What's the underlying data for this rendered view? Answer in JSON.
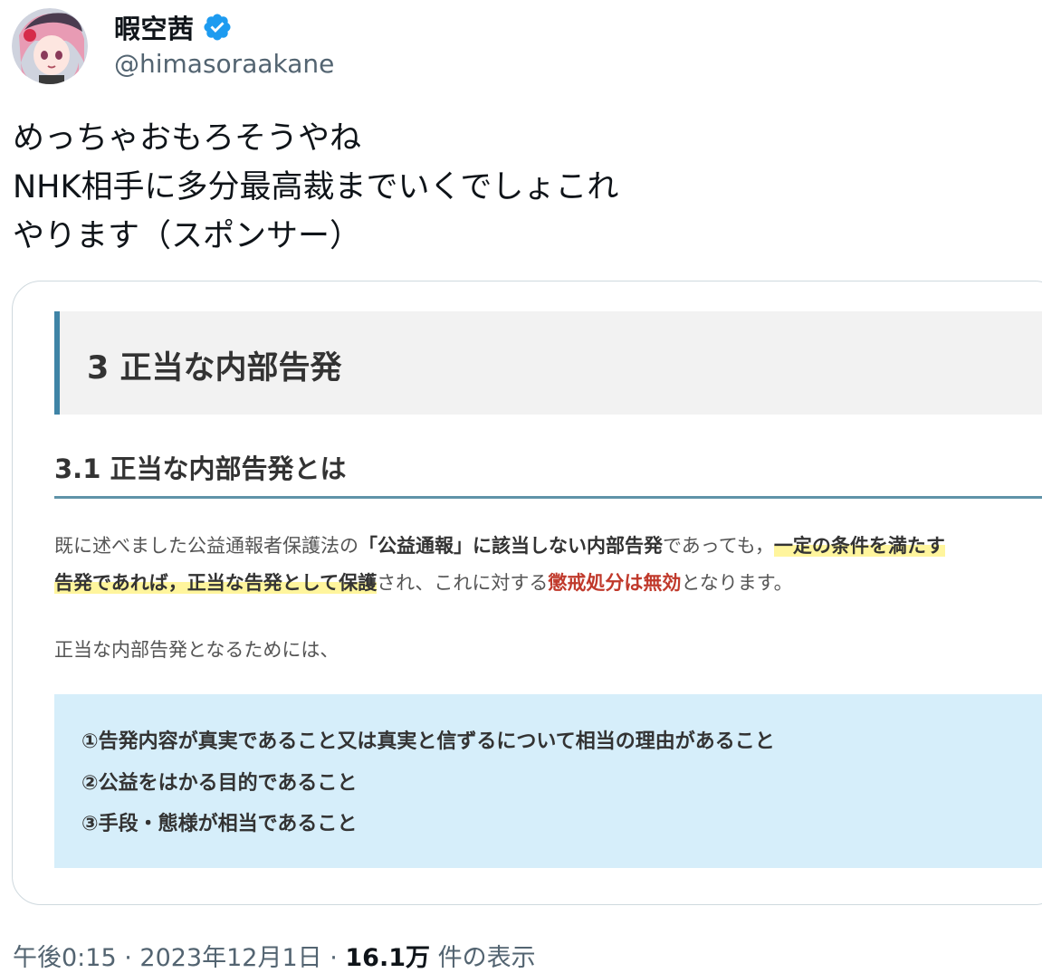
{
  "author": {
    "display_name": "暇空茜",
    "handle": "@himasoraakane",
    "avatar_icon": "avatar-anime-girl",
    "verified_icon": "verified-badge-icon",
    "verified_color": "#1d9bf0"
  },
  "tweet": {
    "lines": [
      "めっちゃおもろそうやね",
      "NHK相手に多分最高裁までいくでしょこれ",
      "やります（スポンサー）"
    ]
  },
  "card": {
    "heading": "3 正当な内部告発",
    "subheading": "3.1 正当な内部告発とは",
    "para1": {
      "t1": "既に述べました公益通報者保護法の",
      "t2": "「公益通報」",
      "t3": "に該当しない内部告発",
      "t4": "であっても，",
      "t5": "一定の条件を満たす"
    },
    "para1b": {
      "t1": "告発であれば，正当な告発として保護",
      "t2": "され、これに対する",
      "t3": "懲戒処分は無効",
      "t4": "となります。"
    },
    "para2": "正当な内部告発となるためには、",
    "conditions": [
      "①告発内容が真実であること又は真実と信ずるについて相当の理由があること",
      "②公益をはかる目的であること",
      "③手段・態様が相当であること"
    ],
    "colors": {
      "heading_bar": "#3f84a6",
      "highlight": "#fff59d",
      "emphasis_red": "#c0392b",
      "conditions_bg": "#d6eefa"
    }
  },
  "meta": {
    "time": "午後0:15",
    "separator": " · ",
    "date": "2023年12月1日",
    "views_count": "16.1万",
    "views_label": " 件の表示"
  }
}
